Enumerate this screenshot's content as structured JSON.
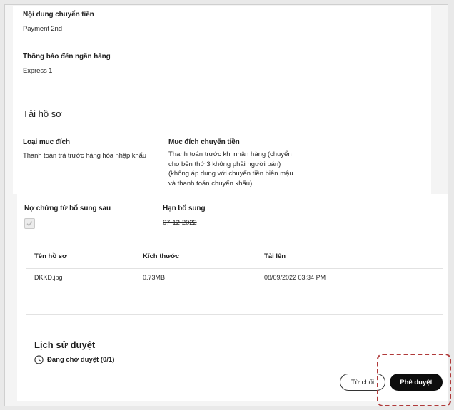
{
  "transfer": {
    "content_label": "Nội dung chuyển tiền",
    "content_value": "Payment 2nd",
    "bank_notice_label": "Thông báo đến ngân hàng",
    "bank_notice_value": "Express 1"
  },
  "documents": {
    "section_title": "Tải hồ sơ",
    "purpose_type_label": "Loại mục đích",
    "purpose_type_value": "Thanh toán trả trước hàng hóa nhập khẩu",
    "purpose_label": "Mục đích chuyển tiền",
    "purpose_lines": [
      "Thanh toán trước khi nhận hàng (chuyển",
      "cho bên thứ 3 không phải người bán)",
      "(không áp dụng với chuyển tiền biên mậu",
      "và thanh toán chuyển khẩu)"
    ],
    "defer_label": "Nợ chứng từ bổ sung sau",
    "defer_checked": true,
    "deadline_label": "Hạn bổ sung",
    "deadline_value": "07-12-2022"
  },
  "files_table": {
    "headers": [
      "Tên hồ sơ",
      "Kích thước",
      "Tải lên"
    ],
    "rows": [
      [
        "DKKD.jpg",
        "0.73MB",
        "08/09/2022 03:34 PM"
      ]
    ]
  },
  "history": {
    "title": "Lịch sử duyệt",
    "status": "Đang chờ duyệt (0/1)",
    "icon": "clock-icon"
  },
  "actions": {
    "reject_label": "Từ chối",
    "approve_label": "Phê duyệt"
  },
  "colors": {
    "approve_bg": "#0d0d0d",
    "highlight": "#b03a3a"
  }
}
